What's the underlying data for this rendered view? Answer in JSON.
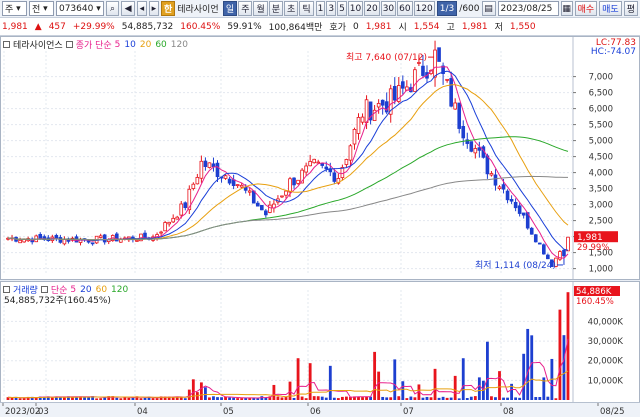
{
  "toolbar": {
    "market_select": "주",
    "chart_type": "전",
    "code": "073640",
    "hangul_btn": "한",
    "name": "테라사이언",
    "period_buttons": [
      "일",
      "주",
      "월",
      "분",
      "초",
      "틱"
    ],
    "minute_buttons": [
      "1",
      "3",
      "5",
      "10",
      "20",
      "30",
      "60",
      "120"
    ],
    "count_badge": "1/3",
    "count_value": "/600",
    "date": "2023/08/25",
    "tab_buy": "매수",
    "tab_sell": "매도",
    "tab_eval": "평"
  },
  "quote": {
    "price": "1,981",
    "change": "457",
    "change_pct": "+29.99%",
    "volume": "54,885,732",
    "volume_pct": "160.45%",
    "ratio": "59.91%",
    "amount": "100,864백만",
    "hoga_label": "호가",
    "hoga_value": "0",
    "hoga_price": "1,981",
    "open_label": "시",
    "open": "1,554",
    "high_label": "고",
    "high": "1,981",
    "low_label": "저",
    "low": "1,550"
  },
  "price_panel": {
    "legend_name": "테라사이언스",
    "legend_ma_label": "종가 단순",
    "legend_ma_periods": [
      "5",
      "10",
      "20",
      "60",
      "120"
    ],
    "lc_label": "LC:77.83",
    "hc_label": "HC:-74.07",
    "high_annotation": "최고 7,640 (07/12)",
    "low_annotation": "최저 1,114 (08/24)",
    "current_price_tag": "1,981",
    "current_pct_tag": "29.99%",
    "y_ticks": [
      "7,000",
      "6,500",
      "6,000",
      "5,500",
      "5,000",
      "4,500",
      "4,000",
      "3,500",
      "3,000",
      "2,500",
      "2,000",
      "1,500",
      "1,000"
    ]
  },
  "vol_panel": {
    "legend_label": "거래량",
    "legend_ma_label": "단순",
    "legend_ma_periods": [
      "5",
      "20",
      "60",
      "120"
    ],
    "legend_value": "54,885,732주(160.45%)",
    "current_tag": "54,886K",
    "current_pct_tag": "160.45%",
    "y_ticks": [
      "40,000K",
      "30,000K",
      "20,000K",
      "10,000K"
    ]
  },
  "x_axis": {
    "labels": [
      "2023/02",
      "03",
      "04",
      "05",
      "06",
      "07",
      "08",
      "08/25"
    ]
  },
  "colors": {
    "up": "#e8141c",
    "down": "#1d3fd0",
    "ma5": "#e8208c",
    "ma10": "#1a3fd8",
    "ma20": "#e8a010",
    "ma60": "#2aa82a",
    "ma120": "#888888"
  },
  "chart_data": {
    "type": "candlestick",
    "x_range": [
      "2023/02",
      "2023/08/25"
    ],
    "price_ylim": [
      1000,
      7640
    ],
    "volume_ylim": [
      0,
      54886000
    ],
    "series_points": [
      {
        "date": "02",
        "close": 1950
      },
      {
        "date": "03",
        "close": 1900
      },
      {
        "date": "04-early",
        "close": 1980
      },
      {
        "date": "04-mid",
        "close": 3000
      },
      {
        "date": "04-late",
        "close": 4300
      },
      {
        "date": "05-early",
        "close": 3800
      },
      {
        "date": "05-mid",
        "close": 2700
      },
      {
        "date": "05-late",
        "close": 3700
      },
      {
        "date": "06-early",
        "close": 4200
      },
      {
        "date": "06-mid",
        "close": 3900
      },
      {
        "date": "06-late",
        "close": 5900
      },
      {
        "date": "07-early",
        "close": 6300
      },
      {
        "date": "07-12",
        "close": 7640
      },
      {
        "date": "07-late",
        "close": 5600
      },
      {
        "date": "08-early",
        "close": 4300
      },
      {
        "date": "08-mid",
        "close": 3000
      },
      {
        "date": "08-24",
        "close": 1114
      },
      {
        "date": "08-25",
        "close": 1981
      }
    ]
  }
}
